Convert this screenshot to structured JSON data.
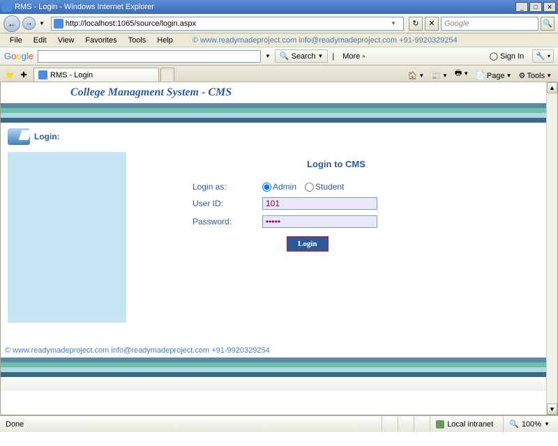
{
  "window": {
    "title": "RMS - Login - Windows Internet Explorer"
  },
  "nav": {
    "url": "http://localhost:1065/source/login.aspx",
    "search_placeholder": "Google"
  },
  "menu": {
    "file": "File",
    "edit": "Edit",
    "view": "View",
    "favorites": "Favorites",
    "tools": "Tools",
    "help": "Help",
    "copyright": "©  www.readymadeproject.com  info@readymadeproject.com  +91-9920329254"
  },
  "googlebar": {
    "search": "Search",
    "more": "More",
    "signin": "Sign In"
  },
  "tabs": {
    "tab0": "RMS - Login",
    "page": "Page",
    "tools": "Tools"
  },
  "app": {
    "banner_title": "College Managment System - CMS",
    "login_label": "Login:",
    "form_title": "Login to CMS",
    "login_as_label": "Login as:",
    "role_admin": "Admin",
    "role_student": "Student",
    "userid_label": "User ID:",
    "userid_value": "101",
    "password_label": "Password:",
    "password_value": "•••••",
    "login_button": "Login",
    "footer_copy": "©  www.readymadeproject.com  info@readymadeproject.com  +91-9920329254"
  },
  "status": {
    "done": "Done",
    "zone": "Local intranet",
    "zoom": "100%"
  },
  "colors": {
    "stripe1": "#5a8aa5",
    "stripe2": "#6ac0aa",
    "stripe3": "#b0d8e0",
    "stripe4": "#3a6a85"
  }
}
